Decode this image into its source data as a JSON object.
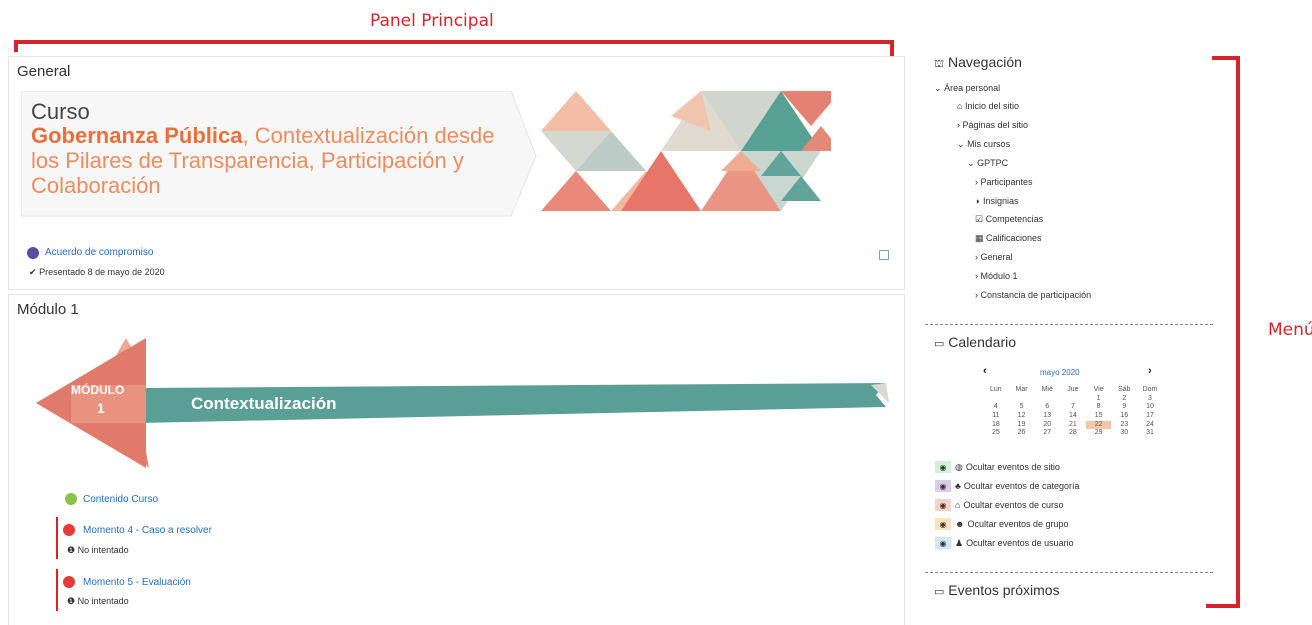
{
  "annotations": {
    "panel_label": "Panel Principal",
    "menu_label": "Menú"
  },
  "general": {
    "title": "General",
    "banner": {
      "line1": "Curso",
      "highlight": "Gobernanza Pública",
      "rest_a": ", Contextualización desde",
      "rest_b": "los Pilares de Transparencia, Participación y",
      "rest_c": "Colaboración"
    },
    "activity": {
      "label": "Acuerdo de compromiso",
      "status": "Presentado 8 de mayo de 2020"
    }
  },
  "modulo1": {
    "title": "Módulo 1",
    "banner": {
      "badge_line1": "MÓDULO",
      "badge_line2": "1",
      "ribbon_text": "Contextualización"
    },
    "items": [
      {
        "label": "Contenido Curso",
        "status": ""
      },
      {
        "label": "Momento 4 - Caso a resolver",
        "status": "No intentado"
      },
      {
        "label": "Momento 5 - Evaluación",
        "status": "No intentado"
      }
    ]
  },
  "navigation": {
    "title": "Navegación",
    "items": [
      "Área personal",
      "Inicio del sitio",
      "Páginas del sitio",
      "Mis cursos",
      "GPTPC",
      "Participantes",
      "Insignias",
      "Competencias",
      "Calificaciones",
      "General",
      "Módulo 1",
      "Constancia de participación"
    ]
  },
  "calendar": {
    "title": "Calendario",
    "month": "mayo 2020",
    "prev": "‹",
    "next": "›",
    "headers": [
      "Lun",
      "Mar",
      "Mié",
      "Jue",
      "Vie",
      "Sáb",
      "Dom"
    ],
    "weeks": [
      [
        "",
        "",
        "",
        "",
        "1",
        "2",
        "3"
      ],
      [
        "4",
        "5",
        "6",
        "7",
        "8",
        "9",
        "10"
      ],
      [
        "11",
        "12",
        "13",
        "14",
        "15",
        "16",
        "17"
      ],
      [
        "18",
        "19",
        "20",
        "21",
        "22",
        "23",
        "24"
      ],
      [
        "25",
        "26",
        "27",
        "28",
        "29",
        "30",
        "31"
      ]
    ],
    "today": "22",
    "filters": [
      "Ocultar eventos de sitio",
      "Ocultar eventos de categoría",
      "Ocultar eventos de curso",
      "Ocultar eventos de grupo",
      "Ocultar eventos de usuario"
    ],
    "filter_colors": [
      "#d1f0d5",
      "#dccbe8",
      "#f6d3c6",
      "#fbe2bd",
      "#d5e6ee"
    ]
  },
  "upcoming": {
    "title": "Eventos próximos"
  },
  "colors": {
    "accent_red": "#d6242b",
    "link": "#1f6ec7",
    "orange": "#ed7d4f",
    "teal": "#5a9f95",
    "coral": "#e07a6b"
  }
}
